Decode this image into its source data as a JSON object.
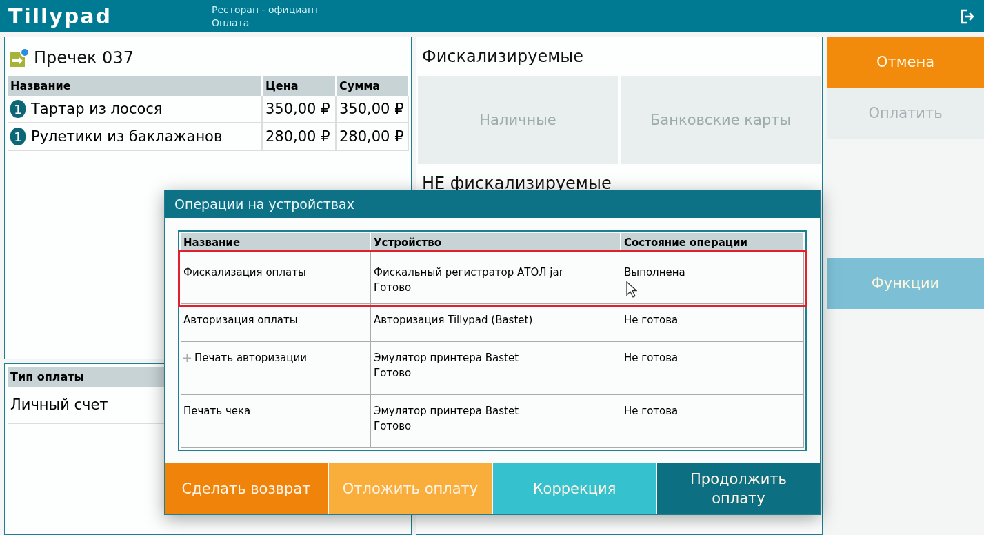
{
  "header": {
    "logo": "Tillypad",
    "title": "Ресторан - официант",
    "subtitle": "Оплата"
  },
  "check": {
    "title": "Пречек 037",
    "columns": [
      "Название",
      "Цена",
      "Сумма"
    ],
    "rows": [
      {
        "qty": "1",
        "name": "Тартар из лосося",
        "price": "350,00 ₽",
        "sum": "350,00 ₽"
      },
      {
        "qty": "1",
        "name": "Рулетики из баклажанов",
        "price": "280,00 ₽",
        "sum": "280,00 ₽"
      }
    ]
  },
  "payment_type": {
    "heading": "Тип оплаты",
    "value": "Личный счет"
  },
  "methods": {
    "fiscal_title": "Фискализируемые",
    "buttons": [
      {
        "label": "Наличные",
        "disabled": true
      },
      {
        "label": "Банковские карты",
        "disabled": true
      }
    ],
    "nonfiscal_title": "НЕ фискализируемые"
  },
  "actions": {
    "top_buttons": [
      {
        "label": "Отмена",
        "color": "#f28a0c",
        "disabled": false
      },
      {
        "label": "Оплатить",
        "color": "#e9eeee",
        "disabled": true
      }
    ],
    "functions_button": {
      "label": "Функции",
      "color": "#7dc0d6",
      "disabled": false
    }
  },
  "dialog": {
    "title": "Операции на устройствах",
    "columns": [
      "Название",
      "Устройство",
      "Состояние операции"
    ],
    "rows": [
      {
        "name": "Фискализация оплаты",
        "expandable": false,
        "device": [
          "Фискальный регистратор АТОЛ jar",
          "Готово"
        ],
        "state": "Выполнена",
        "selected": true
      },
      {
        "name": "Авторизация оплаты",
        "expandable": false,
        "device": [
          "Авторизация Tillypad (Bastet)"
        ],
        "state": "Не готова",
        "selected": false
      },
      {
        "name": "Печать авторизации",
        "expandable": true,
        "device": [
          "Эмулятор принтера Bastet",
          "Готово"
        ],
        "state": "Не готова",
        "selected": false
      },
      {
        "name": "Печать чека",
        "expandable": false,
        "device": [
          "Эмулятор принтера Bastet",
          "Готово"
        ],
        "state": "Не готова",
        "selected": false
      }
    ],
    "buttons": [
      {
        "label": "Сделать возврат",
        "color": "#f0830a"
      },
      {
        "label": "Отложить оплату",
        "color": "#f9ae3c"
      },
      {
        "label": "Коррекция",
        "color": "#36c1cf"
      },
      {
        "label": "Продолжить оплату",
        "color": "#0d6f82"
      }
    ]
  }
}
